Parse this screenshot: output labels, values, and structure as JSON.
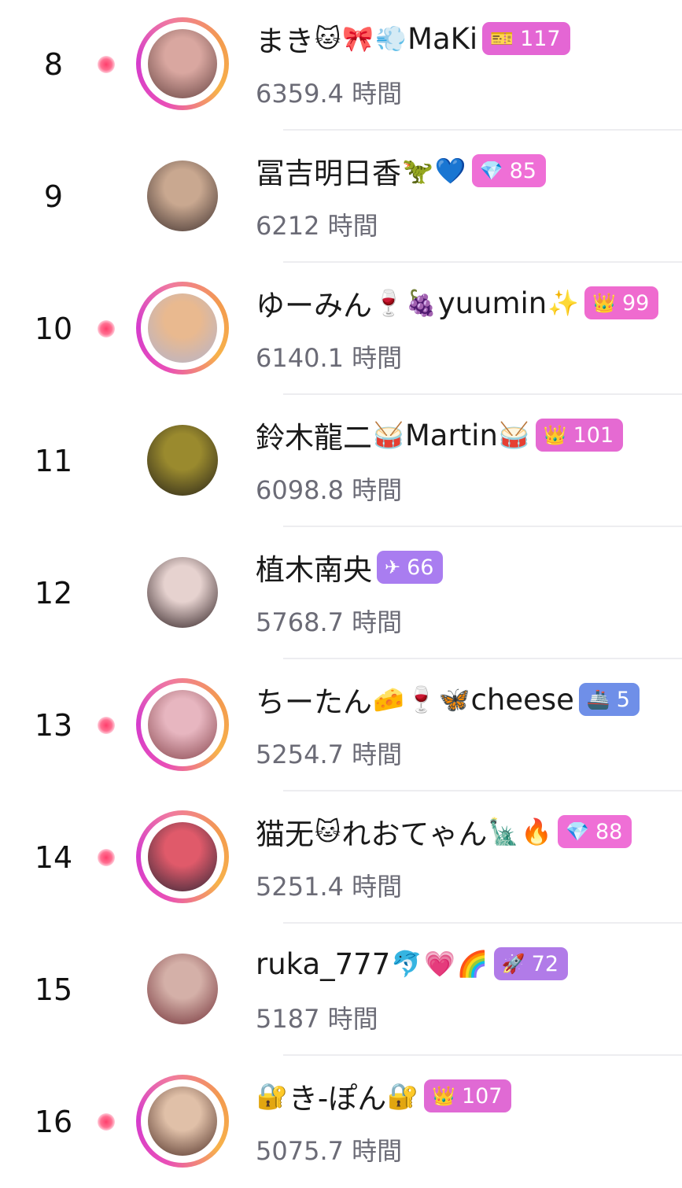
{
  "ranking": {
    "rows": [
      {
        "rank": "8",
        "name_parts": [
          "まき",
          "🐱",
          "🎀",
          "💨",
          "MaKi"
        ],
        "badge": {
          "icon": "🎫",
          "label": "117",
          "color": "#e466d4"
        },
        "hours": "6359.4 時間",
        "live": true,
        "avatar_colors": [
          "#d9a7a0",
          "#6e4a48"
        ]
      },
      {
        "rank": "9",
        "name_parts": [
          "冨吉明日香",
          "🦖",
          "💙"
        ],
        "badge": {
          "icon": "💎",
          "label": "85",
          "color": "#ef6fd6"
        },
        "hours": "6212 時間",
        "live": false,
        "avatar_colors": [
          "#c9a890",
          "#4a3a36"
        ]
      },
      {
        "rank": "10",
        "name_parts": [
          "ゆーみん",
          "🍷",
          "🍇",
          "yuumin",
          "✨"
        ],
        "badge": {
          "icon": "👑",
          "label": "99",
          "color": "#ef6bcf"
        },
        "hours": "6140.1 時間",
        "live": true,
        "avatar_colors": [
          "#e9b98f",
          "#b8b4c8"
        ]
      },
      {
        "rank": "11",
        "name_parts": [
          "鈴木龍二",
          "🥁",
          "Martin",
          "🥁"
        ],
        "badge": {
          "icon": "👑",
          "label": "101",
          "color": "#e56ad2"
        },
        "hours": "6098.8 時間",
        "live": false,
        "avatar_colors": [
          "#9a8a2e",
          "#2f2a1a"
        ]
      },
      {
        "rank": "12",
        "name_parts": [
          "植木南央"
        ],
        "badge": {
          "icon": "✈",
          "label": "66",
          "color": "#a97df0"
        },
        "hours": "5768.7 時間",
        "live": false,
        "avatar_colors": [
          "#e6d2cf",
          "#3a2a2c"
        ]
      },
      {
        "rank": "13",
        "name_parts": [
          "ちーたん",
          "🧀",
          "🍷",
          "🦋",
          "cheese"
        ],
        "badge": {
          "icon": "🚢",
          "label": "5",
          "color": "#6f8fe8"
        },
        "hours": "5254.7 時間",
        "live": true,
        "avatar_colors": [
          "#e7b6c0",
          "#8e4d55"
        ]
      },
      {
        "rank": "14",
        "name_parts": [
          "猫无",
          "🐱",
          "れおてゃん",
          "🗽",
          "🔥"
        ],
        "badge": {
          "icon": "💎",
          "label": "88",
          "color": "#ef6fd6"
        },
        "hours": "5251.4 時間",
        "live": true,
        "avatar_colors": [
          "#e05a6a",
          "#3c2a3a"
        ]
      },
      {
        "rank": "15",
        "name_parts": [
          "ruka_777",
          "🐬",
          "💗",
          "🌈"
        ],
        "badge": {
          "icon": "🚀",
          "label": "72",
          "color": "#b17be8"
        },
        "hours": "5187 時間",
        "live": false,
        "avatar_colors": [
          "#d4b0a8",
          "#7a3a40"
        ]
      },
      {
        "rank": "16",
        "name_parts": [
          "🔐",
          "き-ぽん",
          "🔐"
        ],
        "badge": {
          "icon": "👑",
          "label": "107",
          "color": "#e06ad4"
        },
        "hours": "5075.7 時間",
        "live": true,
        "avatar_colors": [
          "#e0c0a8",
          "#5a3a30"
        ]
      }
    ]
  }
}
